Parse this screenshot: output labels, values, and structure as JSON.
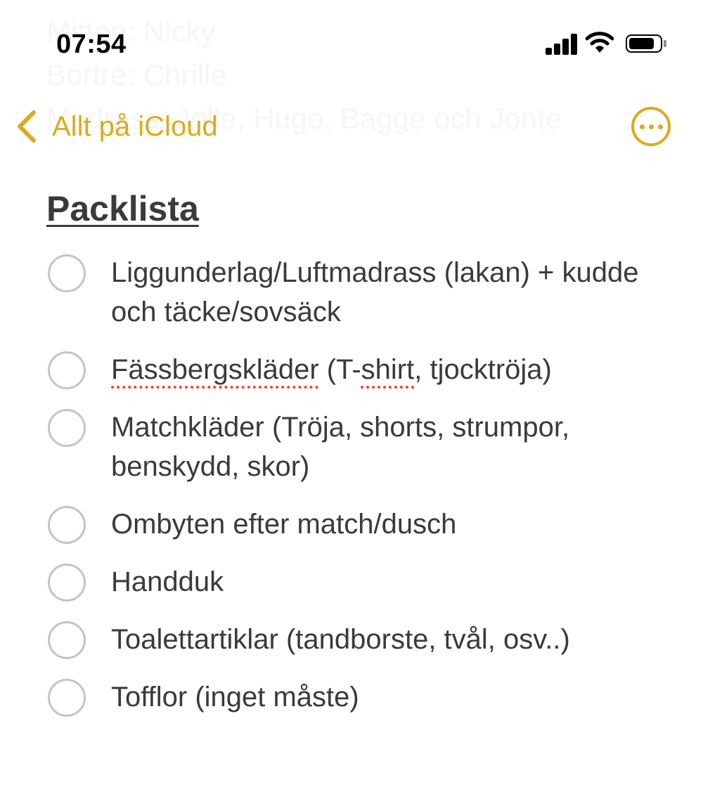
{
  "background_text": [
    "Mitten: Nicky",
    "Bortre: Chrille",
    "Madrass: Jolle, Hugo, Bagge och Jonte"
  ],
  "status_bar": {
    "time": "07:54"
  },
  "nav": {
    "back_label": "Allt på iCloud",
    "back_icon": "chevron-left-icon",
    "more_icon": "ellipsis-circle-icon",
    "accent_color": "#dcaa1e"
  },
  "note": {
    "title": "Packlista",
    "items": [
      {
        "text": "Liggunderlag/Luftmadrass (lakan) + kudde och täcke/sovsäck",
        "checked": false
      },
      {
        "segments": [
          "Fässbergskläder",
          " (T-",
          "shirt",
          ", tjocktröja)"
        ],
        "checked": false
      },
      {
        "text": "Matchkläder (Tröja, shorts, strumpor, benskydd, skor)",
        "checked": false
      },
      {
        "text": "Ombyten efter match/dusch",
        "checked": false
      },
      {
        "text": "Handduk",
        "checked": false
      },
      {
        "text": "Toalettartiklar (tandborste, tvål, osv..)",
        "checked": false
      },
      {
        "text": "Tofflor (inget måste)",
        "checked": false
      }
    ]
  }
}
